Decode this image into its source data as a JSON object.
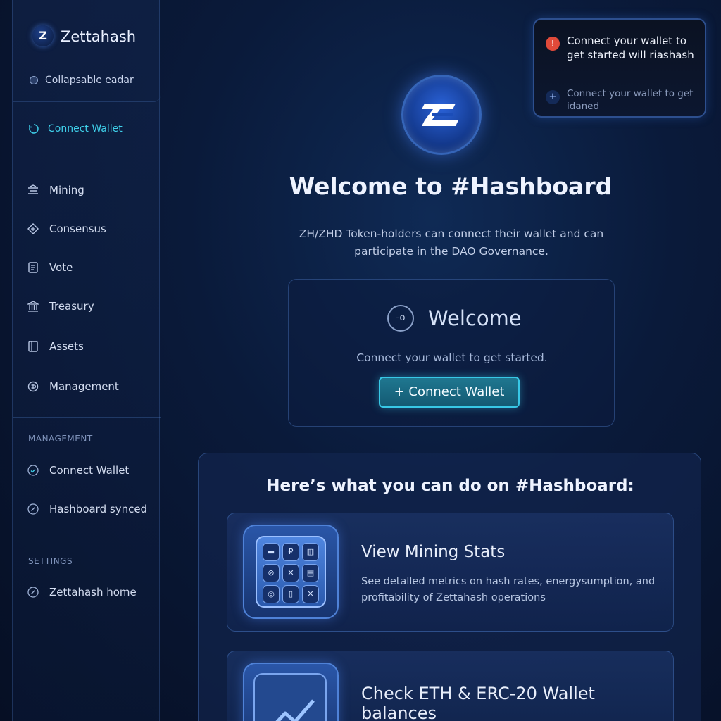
{
  "sidebar": {
    "brand": {
      "logo_glyph": "Z",
      "name": "Zettahash"
    },
    "collapse_label": "Collapsable eadar",
    "wallet_label": "Connect Wallet",
    "nav": [
      {
        "label": "Mining",
        "icon": "mining-icon"
      },
      {
        "label": "Consensus",
        "icon": "consensus-icon"
      },
      {
        "label": "Vote",
        "icon": "vote-icon"
      },
      {
        "label": "Treasury",
        "icon": "treasury-icon"
      },
      {
        "label": "Assets",
        "icon": "assets-icon"
      },
      {
        "label": "Management",
        "icon": "management-icon"
      }
    ],
    "management_label": "MANAGEMENT",
    "management_items": [
      {
        "label": "Connect Wallet",
        "icon": "check-circle-icon"
      },
      {
        "label": "Hashboard synced",
        "icon": "check-circle-icon"
      }
    ],
    "settings_label": "SETTINGS",
    "settings_items": [
      {
        "label": "Zettahash home",
        "icon": "check-circle-icon"
      }
    ]
  },
  "main": {
    "title": "Welcome to #Hashboard",
    "subtitle": "ZH/ZHD Token-holders can connect their wallet and can participate in the DAO Governance.",
    "welcome_card": {
      "icon_glyph": "-o",
      "title": "Welcome",
      "subtitle": "Connect your wallet to get started.",
      "button_label": "+ Connect Wallet"
    },
    "features": {
      "heading": "Here’s what you can do on #Hashboard:",
      "cards": [
        {
          "title": "View Mining Stats",
          "description": "See detalled metrics on hash rates, energysumption, and profitability of Zettahash operations"
        },
        {
          "title": "Check ETH & ERC-20 Wallet balances",
          "description": ""
        }
      ]
    }
  },
  "toast": {
    "alert_glyph": "!",
    "message": "Connect your wallet to get started will riashash",
    "secondary_glyph": "+",
    "secondary": "Connect your wallet to get idaned"
  },
  "colors": {
    "accent": "#3fd0ea",
    "background": "#0a1a3a",
    "alert": "#e04a3a"
  }
}
